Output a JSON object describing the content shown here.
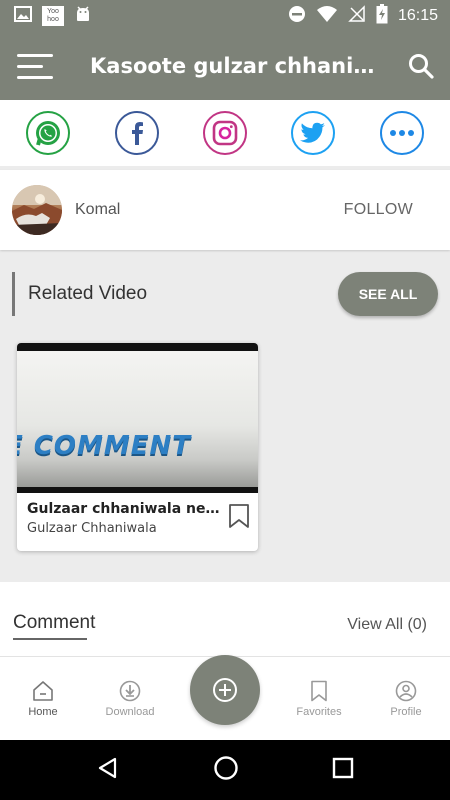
{
  "status_bar": {
    "time": "16:15",
    "yoo_badge": "Yoo hoo",
    "icons": [
      "image-icon",
      "yoohoo-badge",
      "android-icon",
      "dnd-icon",
      "wifi-icon",
      "no-signal-icon",
      "battery-charging-icon"
    ]
  },
  "app_bar": {
    "title": "Kasoote gulzar chhaniwala ne chakkar aa gaye",
    "icons": [
      "menu-icon",
      "search-icon"
    ]
  },
  "share": {
    "items": [
      {
        "name": "whatsapp",
        "color": "#25a244"
      },
      {
        "name": "facebook",
        "color": "#3b5998"
      },
      {
        "name": "instagram",
        "color": "#c13584"
      },
      {
        "name": "twitter",
        "color": "#1da1f2"
      },
      {
        "name": "more",
        "color": "#1e88e5"
      }
    ]
  },
  "author": {
    "name": "Komal",
    "follow_label": "FOLLOW"
  },
  "related": {
    "title": "Related Video",
    "see_all_label": "SEE ALL",
    "videos": [
      {
        "thumbnail_text": "E COMMENT",
        "title": "Gulzaar chhaniwala new song",
        "channel": "Gulzaar Chhaniwala"
      }
    ]
  },
  "comment": {
    "title": "Comment",
    "view_all_label": "View All (0)"
  },
  "bottom_nav": {
    "items": [
      {
        "label": "Home",
        "icon": "home-icon",
        "active": true
      },
      {
        "label": "Download",
        "icon": "download-icon",
        "active": false
      },
      {
        "label": "Favorites",
        "icon": "bookmark-icon",
        "active": false
      },
      {
        "label": "Profile",
        "icon": "profile-icon",
        "active": false
      }
    ],
    "fab_icon": "add-circle-icon"
  },
  "colors": {
    "primary": "#7d8278",
    "background": "#ececec"
  }
}
